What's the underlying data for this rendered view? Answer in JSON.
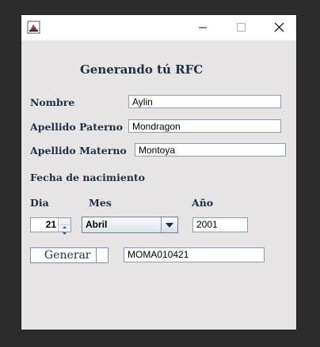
{
  "window": {
    "title": "",
    "controls": {
      "minimize": "minimize-icon",
      "maximize": "maximize-icon",
      "close": "close-icon"
    }
  },
  "form": {
    "heading": "Generando tú RFC",
    "nombre_label": "Nombre",
    "nombre_value": "Aylin",
    "paterno_label": "Apellido Paterno",
    "paterno_value": "Mondragon",
    "materno_label": "Apellido Materno",
    "materno_value": "Montoya",
    "fecha_label": "Fecha de nacimiento",
    "dia_label": "Dia",
    "mes_label": "Mes",
    "anio_label": "Año",
    "dia_value": "21",
    "mes_value": "Abril",
    "anio_value": "2001",
    "generar_label": "Generar",
    "rfc_value": "MOMA010421"
  },
  "colors": {
    "window_bg": "#e6e4e5",
    "label_text": "#1e2f45",
    "field_border": "#8a9db5"
  }
}
